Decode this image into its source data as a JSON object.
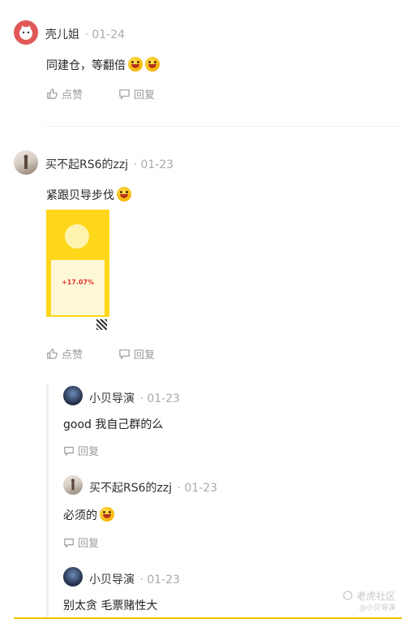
{
  "comments": [
    {
      "user": "壳儿姐",
      "date": "· 01-24",
      "text": "同建仓，等翻倍",
      "actions": {
        "like": "点赞",
        "reply": "回复"
      }
    },
    {
      "user": "买不起RS6的zzj",
      "date": "· 01-23",
      "text": "紧跟贝导步伐",
      "image": {
        "percent": "+17.07%"
      },
      "actions": {
        "like": "点赞",
        "reply": "回复"
      },
      "replies": [
        {
          "user": "小贝导演",
          "date": "· 01-23",
          "text": "good 我自己群的么",
          "reply": "回复"
        },
        {
          "user": "买不起RS6的zzj",
          "date": "· 01-23",
          "text": "必须的",
          "reply": "回复"
        },
        {
          "user": "小贝导演",
          "date": "· 01-23",
          "text": "别太贪 毛票赌性大",
          "reply": "回复"
        }
      ]
    }
  ],
  "watermark": {
    "main": "老虎社区",
    "sub": "@小贝导演"
  },
  "icons": {
    "like": "thumbs-up-icon",
    "reply": "comment-icon",
    "emoji": "laughing-face-emoji",
    "logo": "tiger-icon"
  },
  "colors": {
    "accent": "#f5c400",
    "muted": "#9a9a9a",
    "date": "#aaaaaa"
  }
}
